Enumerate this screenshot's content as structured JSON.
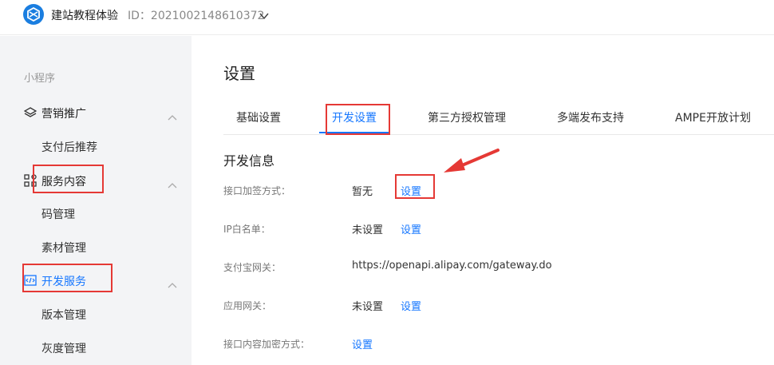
{
  "topbar": {
    "app_name": "建站教程体验",
    "app_id": "ID：2021002148610372",
    "logo_icon": "hexagon-logo-icon",
    "dropdown_icon": "chevron-down-icon"
  },
  "sidebar": {
    "section_title": "小程序",
    "groups": [
      {
        "label": "营销推广",
        "icon": "layers-icon",
        "items": [
          "支付后推荐"
        ]
      },
      {
        "label": "服务内容",
        "icon": "grid-icon",
        "items": [
          "码管理",
          "素材管理"
        ]
      },
      {
        "label": "开发服务",
        "icon": "code-icon",
        "items": [
          "版本管理",
          "灰度管理"
        ],
        "active": true
      }
    ]
  },
  "main": {
    "title": "设置",
    "tabs": [
      {
        "label": "基础设置"
      },
      {
        "label": "开发设置",
        "active": true
      },
      {
        "label": "第三方授权管理"
      },
      {
        "label": "多端发布支持"
      },
      {
        "label": "AMPE开放计划"
      }
    ],
    "section_title": "开发信息",
    "rows": [
      {
        "label": "接口加签方式：",
        "value": "暂无",
        "link": "设置"
      },
      {
        "label": "IP白名单：",
        "value": "未设置",
        "link": "设置"
      },
      {
        "label": "支付宝网关：",
        "value": "https://openapi.alipay.com/gateway.do",
        "link": ""
      },
      {
        "label": "应用网关：",
        "value": "未设置",
        "link": "设置"
      },
      {
        "label": "接口内容加密方式：",
        "value": "",
        "link": "设置"
      }
    ]
  },
  "colors": {
    "accent": "#1677ff",
    "annotation_red": "#e53935",
    "sidebar_bg": "#f3f4f6"
  }
}
